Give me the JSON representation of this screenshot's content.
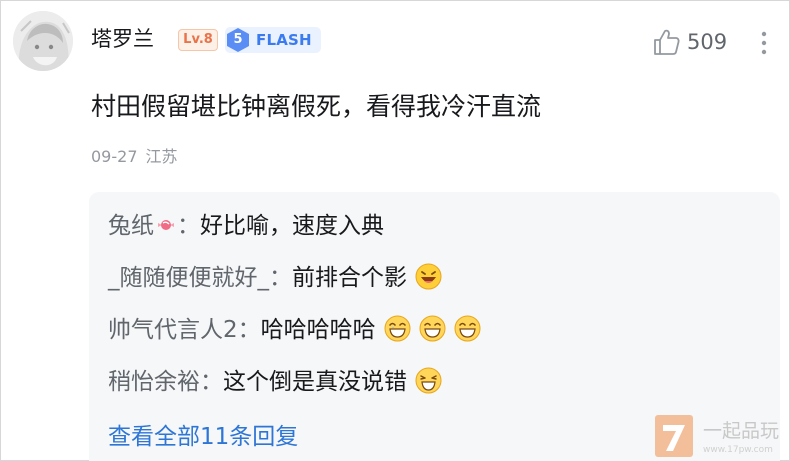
{
  "comment": {
    "username": "塔罗兰",
    "level_badge": "Lv.8",
    "fan_badge": {
      "number": "5",
      "name": "FLASH"
    },
    "like_count": "509",
    "content": "村田假留堪比钟离假死，看得我冷汗直流",
    "date": "09-27",
    "location": "江苏"
  },
  "replies": [
    {
      "username": "兔纸",
      "separator": "：",
      "text": "好比喻，速度入典",
      "emojis": []
    },
    {
      "username": "_随随便便就好_",
      "separator": "：",
      "text": "前排合个影",
      "emojis": [
        "grin-emoji"
      ]
    },
    {
      "username": "帅气代言人2",
      "separator": "：",
      "text": "哈哈哈哈哈",
      "emojis": [
        "laugh-emoji",
        "laugh-emoji",
        "laugh-emoji"
      ]
    },
    {
      "username": "稍怡余裕",
      "separator": "：",
      "text": "这个倒是真没说错",
      "emojis": [
        "smirk-emoji"
      ]
    }
  ],
  "view_all": "查看全部11条回复",
  "watermark": {
    "text": "一起品玩",
    "url": "www.17pw.com"
  },
  "colors": {
    "link": "#2e76d6",
    "level_badge": "#e9734a",
    "fan_badge": "#3a7bf0",
    "muted": "#9499a0",
    "reply_bg": "#f6f7f8"
  }
}
